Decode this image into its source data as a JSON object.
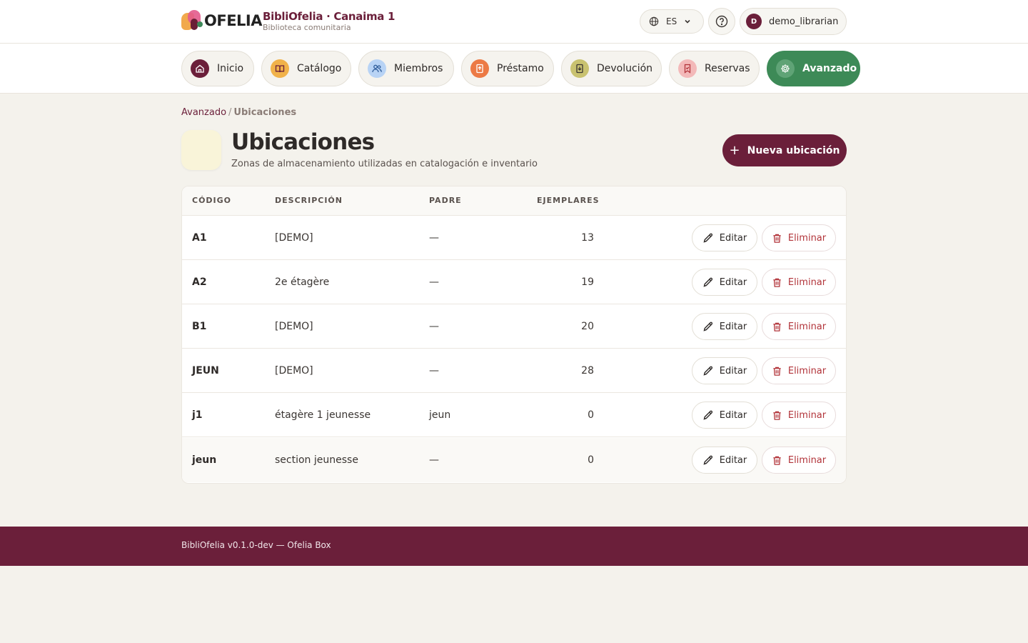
{
  "app": {
    "logo_text": "OFELIA",
    "title": "BibliOfelia · Canaima 1",
    "subtitle": "Biblioteca comunitaria"
  },
  "header": {
    "language": "ES",
    "username": "demo_librarian",
    "avatar_initial": "D"
  },
  "nav": [
    {
      "label": "Inicio",
      "icon": "home-icon",
      "icon_bg": "#6b1f3a",
      "icon_color": "#ffffff",
      "active": false
    },
    {
      "label": "Catálogo",
      "icon": "book-open-icon",
      "icon_bg": "#f1b24a",
      "icon_color": "#6b1f3a",
      "active": false
    },
    {
      "label": "Miembros",
      "icon": "users-icon",
      "icon_bg": "#b8d3f5",
      "icon_color": "#2e5c9a",
      "active": false
    },
    {
      "label": "Préstamo",
      "icon": "book-out-icon",
      "icon_bg": "#ec7a45",
      "icon_color": "#ffffff",
      "active": false
    },
    {
      "label": "Devolución",
      "icon": "book-in-icon",
      "icon_bg": "#c9c270",
      "icon_color": "#3a3532",
      "active": false
    },
    {
      "label": "Reservas",
      "icon": "bookmark-icon",
      "icon_bg": "#f3b9b9",
      "icon_color": "#b2343a",
      "active": false
    },
    {
      "label": "Avanzado",
      "icon": "gear-icon",
      "icon_bg": "#5fa376",
      "icon_color": "#ffffff",
      "active": true
    }
  ],
  "breadcrumb": {
    "parent": "Avanzado",
    "separator": "/",
    "current": "Ubicaciones"
  },
  "page": {
    "title": "Ubicaciones",
    "subtitle": "Zonas de almacenamiento utilizadas en catalogación e inventario",
    "new_button": "Nueva ubicación"
  },
  "table": {
    "headers": [
      "CÓDIGO",
      "DESCRIPCIÓN",
      "PADRE",
      "EJEMPLARES"
    ],
    "edit_label": "Editar",
    "delete_label": "Eliminar",
    "rows": [
      {
        "code": "A1",
        "description": "[DEMO]",
        "parent": "—",
        "count": "13"
      },
      {
        "code": "A2",
        "description": "2e étagère",
        "parent": "—",
        "count": "19"
      },
      {
        "code": "B1",
        "description": "[DEMO]",
        "parent": "—",
        "count": "20"
      },
      {
        "code": "JEUN",
        "description": "[DEMO]",
        "parent": "—",
        "count": "28"
      },
      {
        "code": "j1",
        "description": "étagère 1 jeunesse",
        "parent": "jeun",
        "count": "0"
      },
      {
        "code": "jeun",
        "description": "section jeunesse",
        "parent": "—",
        "count": "0"
      }
    ]
  },
  "footer": {
    "text": "BibliOfelia v0.1.0-dev — Ofelia Box"
  }
}
